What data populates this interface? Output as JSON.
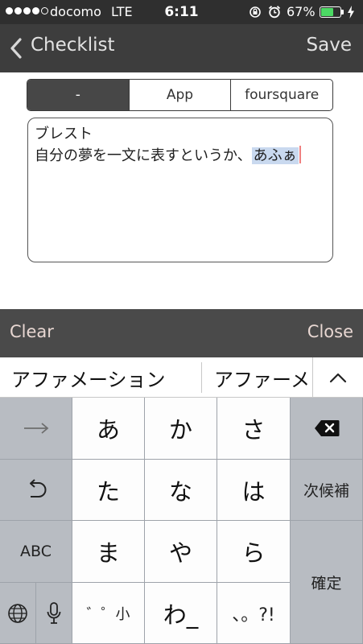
{
  "status_bar": {
    "signal_dots": 5,
    "signal_filled": 4,
    "carrier": "docomo",
    "network": "LTE",
    "time": "6:11",
    "battery_percent": "67%",
    "battery_level": 0.67,
    "battery_color": "#4cd964",
    "icons": [
      "rotation-lock-icon",
      "alarm-icon",
      "charging-bolt-icon"
    ]
  },
  "nav": {
    "back_label": "Checklist",
    "save_label": "Save",
    "back_icon": "chevron-left-icon"
  },
  "segments": [
    {
      "label": "-",
      "active": true
    },
    {
      "label": "App",
      "active": false
    },
    {
      "label": "foursquare",
      "active": false
    }
  ],
  "memo": {
    "line1": "ブレスト",
    "line2": "自分の夢を一文に表すというか、",
    "composing": "あふぁ"
  },
  "accessory": {
    "clear_label": "Clear",
    "close_label": "Close"
  },
  "candidates": {
    "items": [
      "アファメーション",
      "アファーメ"
    ],
    "more_icon": "chevron-up-icon"
  },
  "keyboard": {
    "kana_keys": [
      "あ",
      "か",
      "さ",
      "た",
      "な",
      "は",
      "ま",
      "や",
      "ら",
      "わ_"
    ],
    "dakuten_key": "゛゜小",
    "punct_key": "、。?!",
    "abc_label": "ABC",
    "next_candidate_label": "次候補",
    "confirm_label": "確定",
    "icons": [
      "arrow-right-icon",
      "undo-icon",
      "globe-icon",
      "microphone-icon",
      "delete-icon"
    ]
  }
}
